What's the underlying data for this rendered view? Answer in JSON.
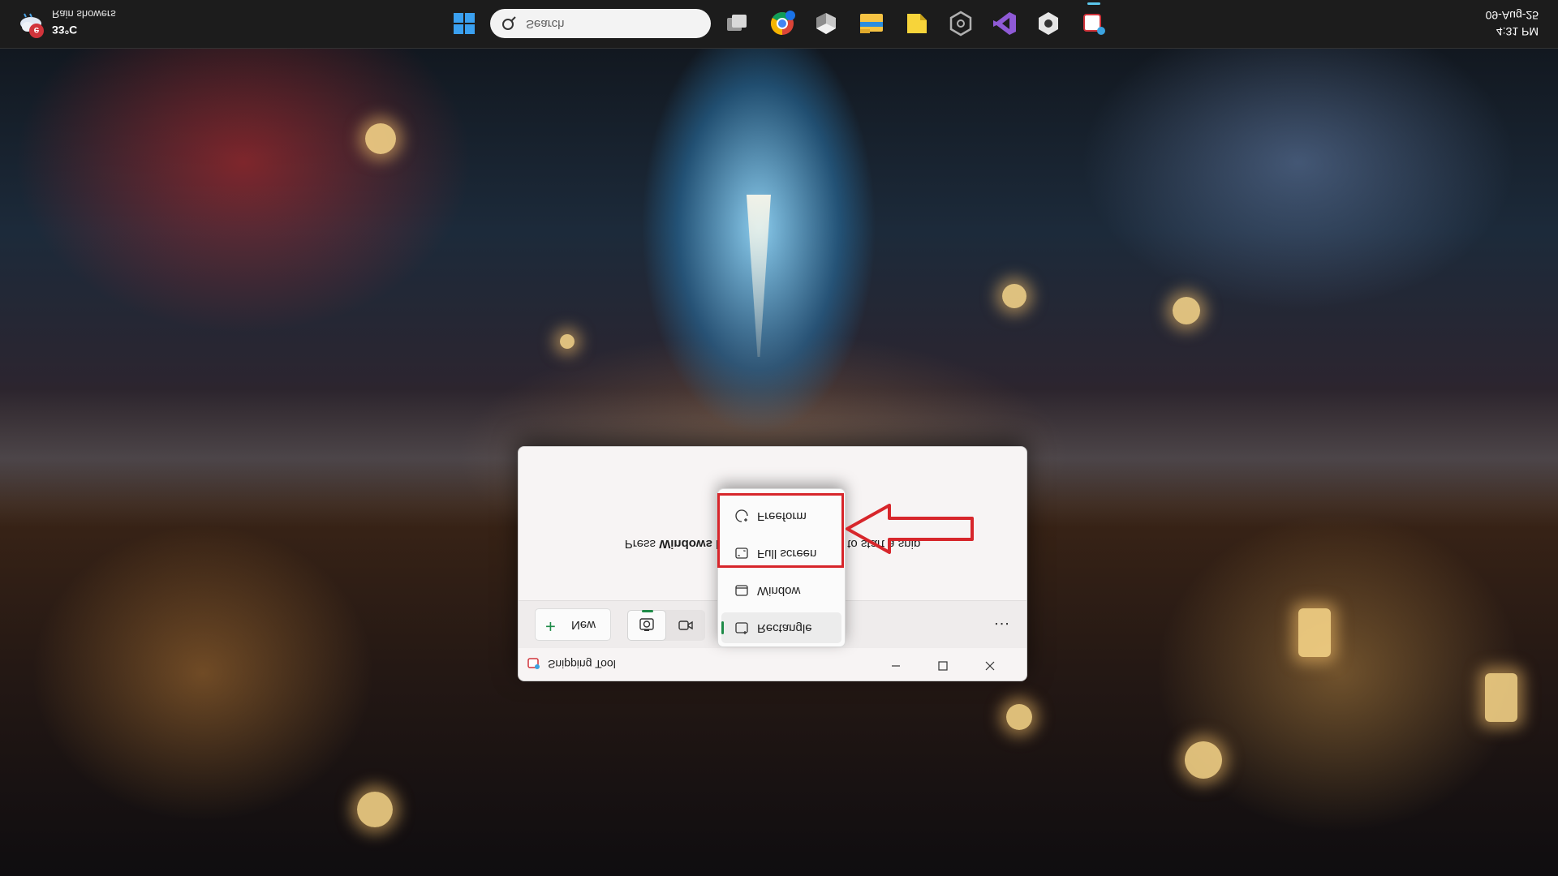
{
  "taskbar": {
    "weather": {
      "temp": "33°C",
      "description": "Rain showers",
      "badge": "e"
    },
    "search": {
      "placeholder": "Search"
    },
    "icons": [
      "start-icon",
      "task-view-icon",
      "chrome-icon",
      "box-app-icon",
      "file-explorer-icon",
      "sticky-notes-icon",
      "settings-hex-icon",
      "visual-studio-icon",
      "dev-app-icon",
      "snipping-tool-icon"
    ],
    "clock": {
      "time": "4:31 PM",
      "date": "09-Aug-25"
    },
    "colors": {
      "background": "#1c1c1c",
      "active_indicator": "#5bc7ec"
    }
  },
  "snipping_tool": {
    "title": "Snipping Tool",
    "toolbar": {
      "new_label": "New",
      "more_label": "..."
    },
    "modes": [
      "screenshot-mode",
      "video-mode"
    ],
    "selected_mode": "screenshot-mode",
    "body": {
      "before": "Press ",
      "bold": "Windows l",
      "after": "to start a snip"
    },
    "window_controls": [
      "minimize",
      "maximize",
      "close"
    ]
  },
  "snip_menu": {
    "items": [
      {
        "label": "Rectangle",
        "icon": "rectangle-snip-icon",
        "selected": true
      },
      {
        "label": "Window",
        "icon": "window-snip-icon",
        "selected": false
      },
      {
        "label": "Full screen",
        "icon": "full-screen-snip-icon",
        "selected": false
      },
      {
        "label": "Freeform",
        "icon": "freeform-snip-icon",
        "selected": false
      }
    ]
  },
  "annotation": {
    "color": "#d7262b"
  },
  "accent": "#1f8b48"
}
